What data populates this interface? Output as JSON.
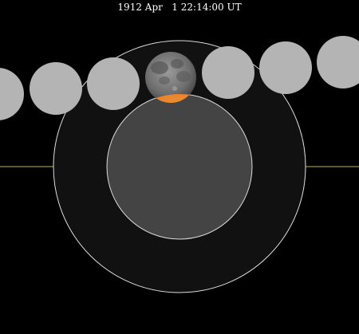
{
  "header": {
    "title": "1912 Apr   1 22:14:00 UT"
  },
  "colors": {
    "background": "#000000",
    "penumbra": "#111111",
    "umbra": "#444444",
    "outline": "#dcdcdc",
    "ecliptic": "#b6b35c",
    "moon_positions": "#b4b4b4",
    "moon_shaded": "#e86a10"
  },
  "diagram": {
    "moon_sequence_count": 7,
    "current_moon_index": 3,
    "icon": "moon-icon"
  }
}
